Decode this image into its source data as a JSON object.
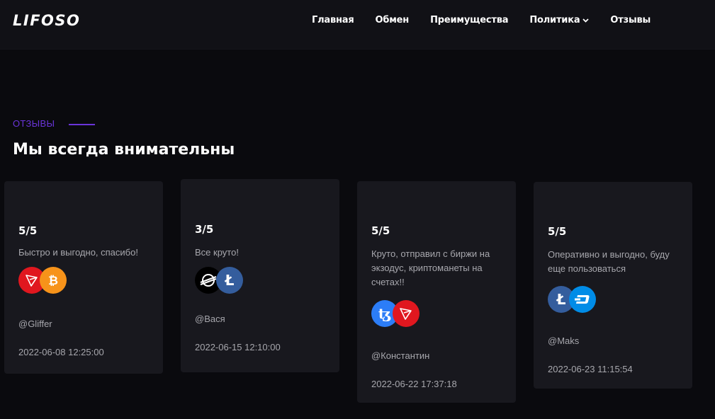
{
  "header": {
    "logo": "LIFOSO",
    "nav": [
      {
        "label": "Главная"
      },
      {
        "label": "Обмен"
      },
      {
        "label": "Преимущества"
      },
      {
        "label": "Политика",
        "has_dropdown": true
      },
      {
        "label": "Отзывы"
      }
    ]
  },
  "section": {
    "label": "ОТЗЫВЫ",
    "title": "Мы всегда внимательны",
    "accent_color": "#6a34d9"
  },
  "reviews": [
    {
      "rating": "5/5",
      "text": "Быстро и выгодно, спасибо!",
      "coins": [
        "tron-icon",
        "bitcoin-icon"
      ],
      "author": "@Gliffer",
      "date": "2022-06-08 12:25:00"
    },
    {
      "rating": "3/5",
      "text": "Все круто!",
      "coins": [
        "stellar-icon",
        "litecoin-icon"
      ],
      "author": "@Вася",
      "date": "2022-06-15 12:10:00"
    },
    {
      "rating": "5/5",
      "text": "Круто, отправил с биржи на экзодус, криптоманеты на счетах!!",
      "coins": [
        "tezos-icon",
        "tron-icon"
      ],
      "author": "@Константин",
      "date": "2022-06-22 17:37:18"
    },
    {
      "rating": "5/5",
      "text": "Оперативно и выгодно, буду еще пользоваться",
      "coins": [
        "litecoin-icon",
        "dash-icon"
      ],
      "author": "@Maks",
      "date": "2022-06-23 11:15:54"
    }
  ],
  "colors": {
    "background": "#0a0a0e",
    "header": "#111116",
    "card": "#18181e",
    "tron": "#e0171f",
    "bitcoin": "#f7931a",
    "litecoin": "#345d9d",
    "tezos": "#2c7df7",
    "dash": "#008ce7",
    "stellar": "#000000"
  }
}
